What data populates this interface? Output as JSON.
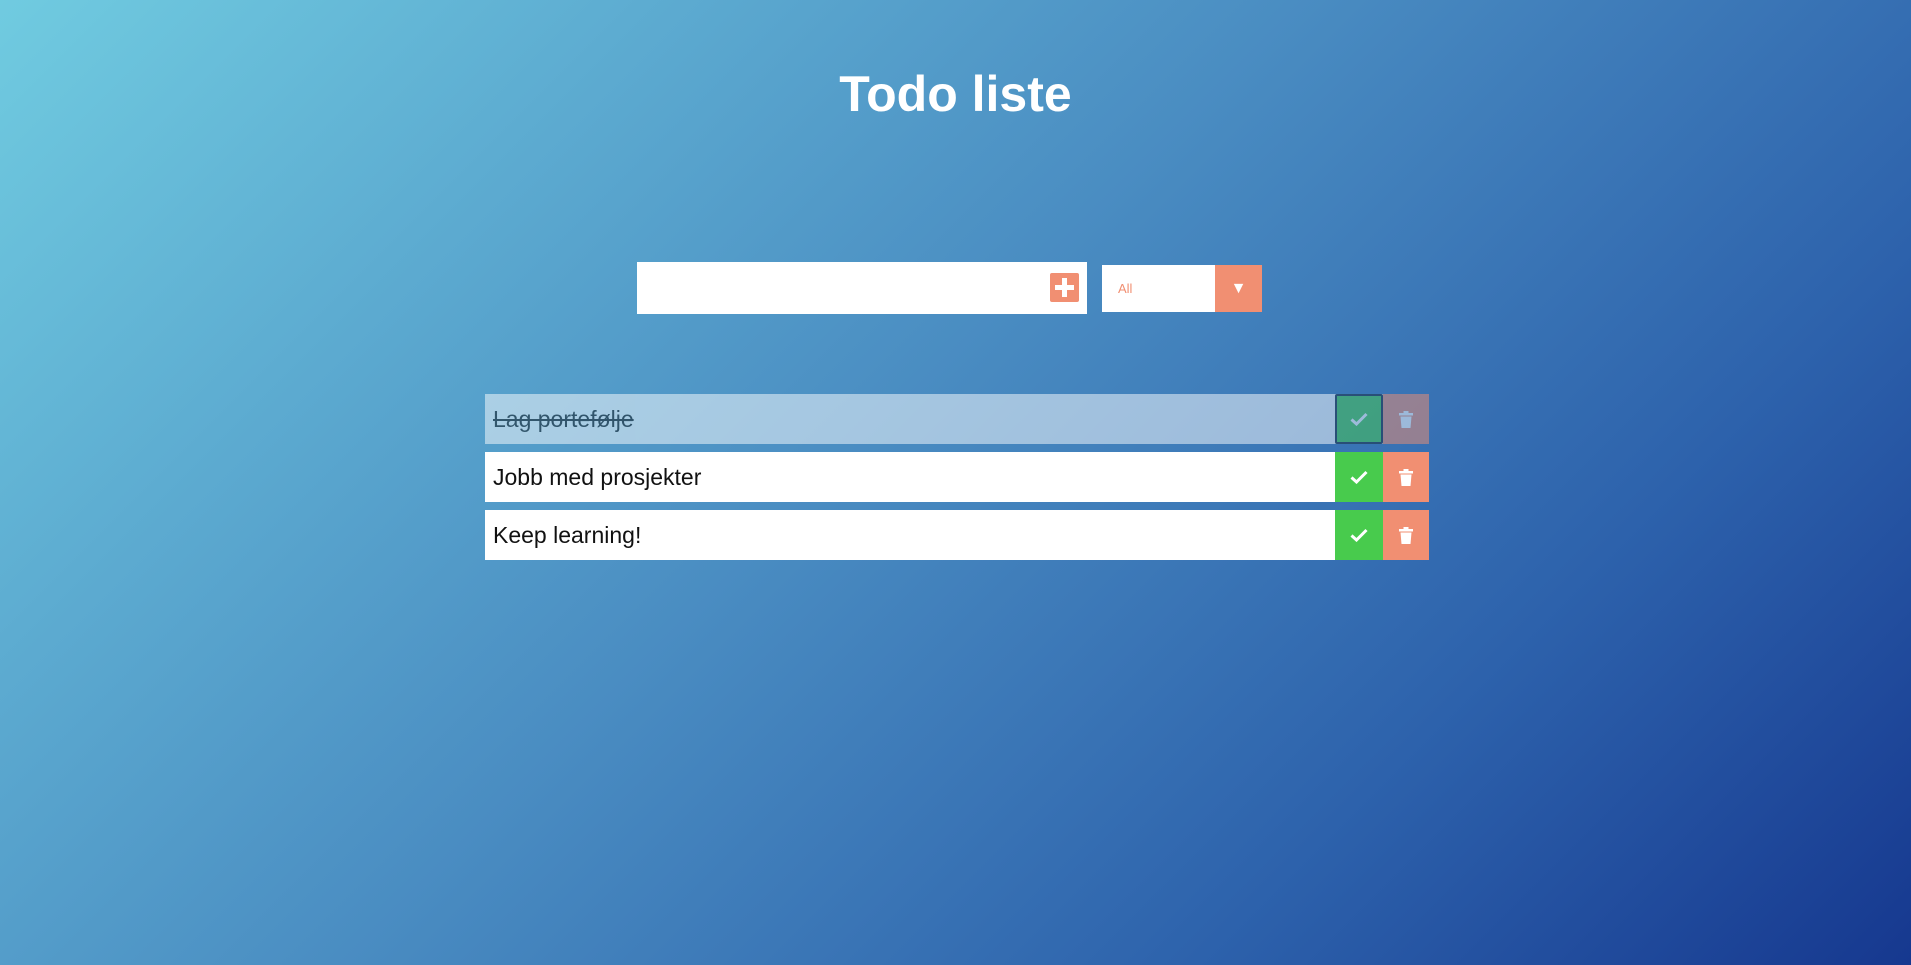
{
  "header": {
    "title": "Todo liste"
  },
  "form": {
    "input_value": "",
    "add_icon": "plus-square-icon",
    "filter_selected": "All",
    "filter_arrow_icon": "triangle-down-icon"
  },
  "todos": [
    {
      "text": "Lag portefølje",
      "completed": true
    },
    {
      "text": "Jobb med prosjekter",
      "completed": false
    },
    {
      "text": "Keep learning!",
      "completed": false
    }
  ],
  "colors": {
    "accent": "#f18f72",
    "complete": "#48cb4d",
    "background_start": "#70cbe0",
    "background_end": "#16388f"
  }
}
